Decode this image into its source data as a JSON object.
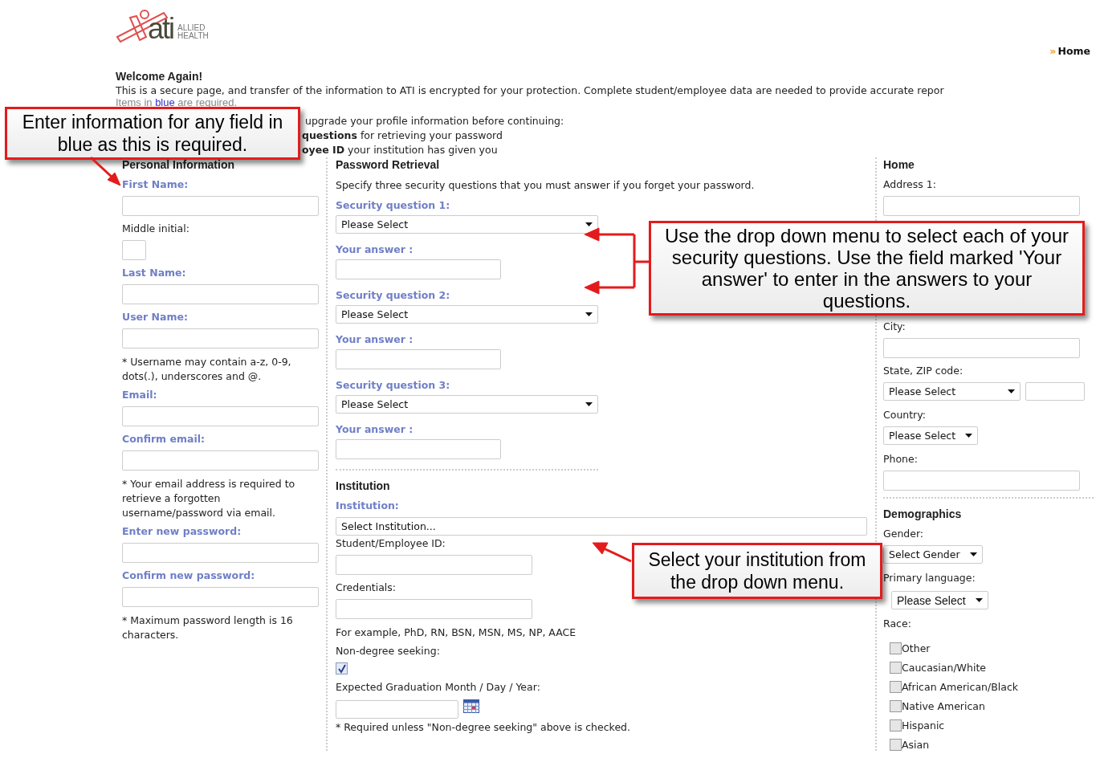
{
  "header": {
    "logo_text": "ati",
    "logo_sub": [
      "ALLIED",
      "HEALTH"
    ],
    "nav_marker": "»",
    "nav_link": "Home"
  },
  "intro": {
    "title": "Welcome Again!",
    "text": "This is a secure page, and transfer of the information to ATI is encrypted for your protection. Complete student/employee data are needed to provide accurate repor",
    "required_note": {
      "before": "Items in",
      "highlight": "blue",
      "after": "are required."
    },
    "upgrade_text": "upgrade your profile information before continuing:",
    "bullets": [
      "**questions** for retrieving your password",
      "**oyee ID** your institution has given you"
    ]
  },
  "personal": {
    "title": "Personal Information",
    "items": [
      {
        "kind": "field",
        "label": "First Name:",
        "required": true
      },
      {
        "kind": "short_field",
        "label": "Middle initial:",
        "required": false
      },
      {
        "kind": "field",
        "label": "Last Name:",
        "required": true
      },
      {
        "kind": "field",
        "label": "User Name:",
        "required": true
      },
      {
        "kind": "note",
        "label": "* Username may contain a-z, 0-9, dots(.), underscores and @."
      },
      {
        "kind": "field",
        "label": "Email:",
        "required": true
      },
      {
        "kind": "field",
        "label": "Confirm email:",
        "required": true
      },
      {
        "kind": "note",
        "label": "* Your email address is required to retrieve a forgotten username/password via email."
      },
      {
        "kind": "field",
        "label": "Enter new password:",
        "required": true
      },
      {
        "kind": "field",
        "label": "Confirm new password:",
        "required": true
      },
      {
        "kind": "note",
        "label": "* Maximum password length is 16 characters."
      }
    ]
  },
  "password": {
    "title": "Password Retrieval",
    "intro": "Specify three security questions that you must answer if you forget your password.",
    "questions": [
      {
        "label": "Security question 1:",
        "select": "Please Select",
        "answer_label": "Your answer :"
      },
      {
        "label": "Security question 2:",
        "select": "Please Select",
        "answer_label": "Your answer :"
      },
      {
        "label": "Security question 3:",
        "select": "Please Select",
        "answer_label": "Your answer :"
      }
    ]
  },
  "institution": {
    "title": "Institution",
    "items": [
      {
        "kind": "select",
        "label": "Institution:",
        "required": true,
        "value": "Select Institution..."
      },
      {
        "kind": "field",
        "label": "Student/Employee ID:",
        "required": false
      },
      {
        "kind": "field",
        "label": "Credentials:",
        "required": false
      },
      {
        "kind": "note",
        "label": "For example, PhD, RN, BSN, MSN, MS, NP, AACE"
      },
      {
        "kind": "checkbox",
        "label": "Non-degree seeking:",
        "required": false,
        "checked": true
      },
      {
        "kind": "date",
        "label": "Expected Graduation Month / Day / Year:",
        "required": false
      },
      {
        "kind": "note",
        "label": "* Required unless \"Non-degree seeking\" above is checked."
      }
    ]
  },
  "home": {
    "title": "Home",
    "items": [
      {
        "kind": "field",
        "label": "Address 1:"
      },
      {
        "kind": "field",
        "label": "City:"
      },
      {
        "kind": "select_pair",
        "label": "State, ZIP code:",
        "value": "Please Select"
      },
      {
        "kind": "select",
        "label": "Country:",
        "value": "Please Select"
      },
      {
        "kind": "field",
        "label": "Phone:"
      }
    ]
  },
  "demographics": {
    "title": "Demographics",
    "items": [
      {
        "kind": "select",
        "label": "Gender:",
        "value": "Select Gender"
      },
      {
        "kind": "select",
        "label": "Primary language:",
        "value": "Please Select"
      },
      {
        "kind": "checkboxes",
        "label": "Race:",
        "options": [
          {
            "label": "Other",
            "checked": false
          },
          {
            "label": "Caucasian/White",
            "checked": false
          },
          {
            "label": "African American/Black",
            "checked": false
          },
          {
            "label": "Native American",
            "checked": false
          },
          {
            "label": "Hispanic",
            "checked": false
          },
          {
            "label": "Asian",
            "checked": false
          }
        ]
      }
    ]
  },
  "callouts": [
    "Enter information for any field in blue as this is required.",
    "Use the drop down menu to select each of your security questions. Use the field marked 'Your answer' to enter in the answers to your questions.",
    "Select your institution from the drop down menu."
  ]
}
